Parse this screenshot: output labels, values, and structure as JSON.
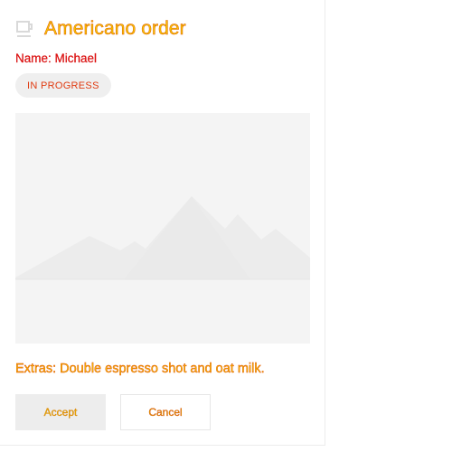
{
  "card": {
    "icon": "coffee-cup-icon",
    "title": "Americano order",
    "name_line": "Name: Michael",
    "badge": "IN PROGRESS",
    "image_icon": "mountain-placeholder-icon",
    "extras": "Extras: Double espresso shot and oat milk.",
    "accept_label": "Accept",
    "cancel_label": "Cancel"
  },
  "colors": {
    "title_fill": "#f6c700",
    "name_text": "#e01010",
    "badge_bg": "#efefef",
    "placeholder_bg": "#f4f4f4"
  }
}
